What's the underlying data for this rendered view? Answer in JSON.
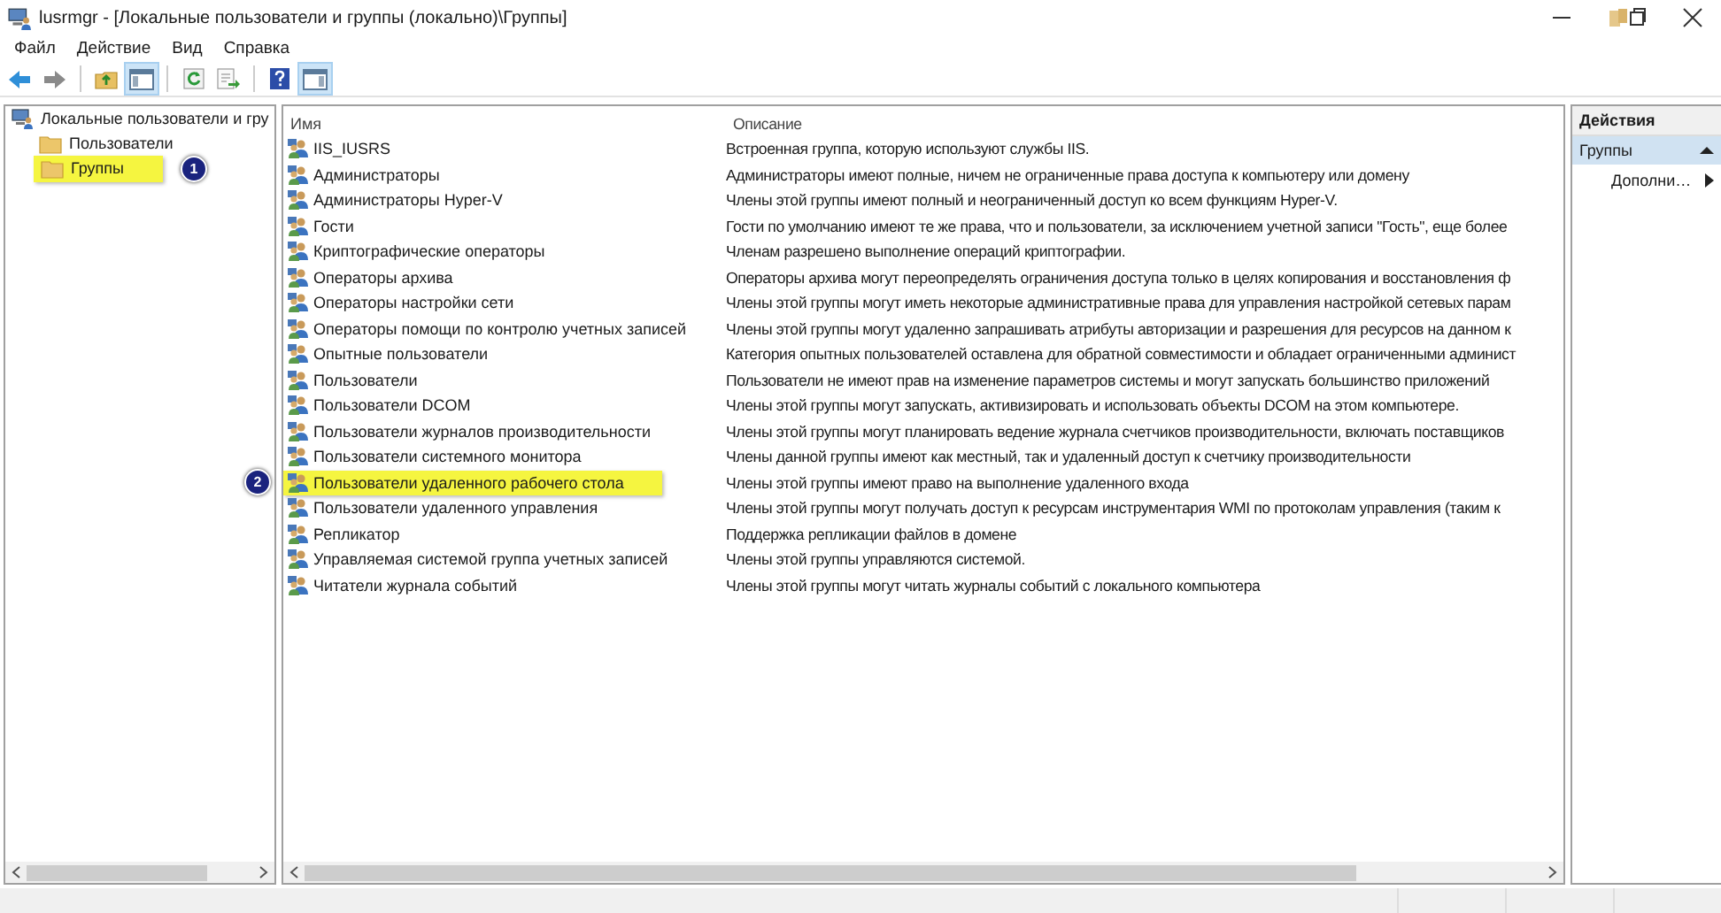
{
  "window": {
    "title": "lusrmgr - [Локальные пользователи и группы (локально)\\Группы]"
  },
  "menu": [
    "Файл",
    "Действие",
    "Вид",
    "Справка"
  ],
  "toolbar": [
    [
      {
        "kind": "back",
        "pressed": false
      },
      {
        "kind": "forward",
        "pressed": false
      }
    ],
    [
      {
        "kind": "up",
        "pressed": false
      },
      {
        "kind": "tree",
        "pressed": true
      }
    ],
    [
      {
        "kind": "refresh",
        "pressed": false
      },
      {
        "kind": "export",
        "pressed": false
      }
    ],
    [
      {
        "kind": "help",
        "pressed": false
      },
      {
        "kind": "actions",
        "pressed": true
      }
    ]
  ],
  "tree": {
    "label": "Локальные пользователи и гру",
    "selected": false,
    "children": [
      {
        "label": "Пользователи",
        "selected": false
      },
      {
        "label": "Группы",
        "selected": true
      }
    ]
  },
  "table": {
    "columns": [
      "Имя",
      "Описание"
    ],
    "rows": [
      {
        "name": "IIS_IUSRS",
        "description": "Встроенная группа, которую используют службы IIS.",
        "selected": false
      },
      {
        "name": "Администраторы",
        "description": "Администраторы имеют полные, ничем не ограниченные права доступа к компьютеру или домену",
        "selected": false
      },
      {
        "name": "Администраторы Hyper-V",
        "description": "Члены этой группы имеют полный и неограниченный доступ ко всем функциям Hyper-V.",
        "selected": false
      },
      {
        "name": "Гости",
        "description": "Гости по умолчанию имеют те же права, что и пользователи, за исключением учетной записи \"Гость\", еще более",
        "selected": false
      },
      {
        "name": "Криптографические операторы",
        "description": "Членам разрешено выполнение операций криптографии.",
        "selected": false
      },
      {
        "name": "Операторы архива",
        "description": "Операторы архива могут переопределять ограничения доступа только в целях копирования и восстановления ф",
        "selected": false
      },
      {
        "name": "Операторы настройки сети",
        "description": "Члены этой группы могут иметь некоторые административные права для управления настройкой сетевых парам",
        "selected": false
      },
      {
        "name": "Операторы помощи по контролю учетных записей",
        "description": "Члены этой группы могут удаленно запрашивать атрибуты авторизации и разрешения для ресурсов на данном к",
        "selected": false
      },
      {
        "name": "Опытные пользователи",
        "description": "Категория опытных пользователей оставлена для обратной совместимости и обладает ограниченными админист",
        "selected": false
      },
      {
        "name": "Пользователи",
        "description": "Пользователи не имеют прав на изменение параметров системы и могут запускать большинство приложений",
        "selected": false
      },
      {
        "name": "Пользователи DCOM",
        "description": "Члены этой группы могут запускать, активизировать и использовать объекты DCOM на этом компьютере.",
        "selected": false
      },
      {
        "name": "Пользователи журналов производительности",
        "description": "Члены этой группы могут планировать ведение журнала счетчиков производительности, включать поставщиков",
        "selected": false
      },
      {
        "name": "Пользователи системного монитора",
        "description": "Члены данной группы имеют как местный, так и удаленный доступ к счетчику производительности",
        "selected": false
      },
      {
        "name": "Пользователи удаленного рабочего стола",
        "description": "Члены этой группы имеют право на выполнение удаленного входа",
        "selected": true
      },
      {
        "name": "Пользователи удаленного управления",
        "description": "Члены этой группы могут получать доступ к ресурсам инструментария WMI по протоколам управления (таким к",
        "selected": false
      },
      {
        "name": "Репликатор",
        "description": "Поддержка репликации файлов в домене",
        "selected": false
      },
      {
        "name": "Управляемая системой группа учетных записей",
        "description": "Члены этой группы управляются системой.",
        "selected": false
      },
      {
        "name": "Читатели журнала событий",
        "description": "Члены этой группы могут читать журналы событий с локального компьютера",
        "selected": false
      }
    ]
  },
  "actions": {
    "title": "Действия",
    "section": {
      "label": "Группы",
      "expanded": true
    },
    "items": [
      {
        "label": "Дополни…",
        "submenu": true
      }
    ]
  },
  "annotations": [
    "1",
    "2"
  ]
}
